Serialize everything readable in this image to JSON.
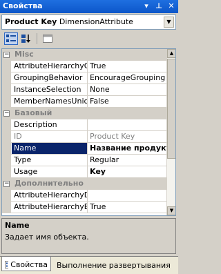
{
  "window": {
    "title": "Свойства",
    "pin_glyph": "▾",
    "autohide_glyph": "⊥",
    "close_glyph": "✕"
  },
  "object": {
    "name": "Product Key",
    "type": "DimensionAttribute",
    "dropdown_glyph": "▼"
  },
  "toolbar": {
    "categorized": "categorized-icon",
    "alphabetical": "sort-alpha-icon",
    "pages": "property-pages-icon"
  },
  "grid": {
    "misc": {
      "title": "Misc",
      "expander": "−",
      "rows": [
        {
          "name": "AttributeHierarchyOrc",
          "value": "True"
        },
        {
          "name": "GroupingBehavior",
          "value": "EncourageGrouping"
        },
        {
          "name": "InstanceSelection",
          "value": "None"
        },
        {
          "name": "MemberNamesUnique",
          "value": "False"
        }
      ]
    },
    "basic": {
      "title": "Базовый",
      "expander": "−",
      "rows": [
        {
          "name": "Description",
          "value": ""
        },
        {
          "name": "ID",
          "value": "Product Key"
        },
        {
          "name": "Name",
          "value": "Название продукт"
        },
        {
          "name": "Type",
          "value": "Regular"
        },
        {
          "name": "Usage",
          "value": "Key"
        }
      ]
    },
    "advanced": {
      "title": "Дополнительно",
      "expander": "−",
      "rows": [
        {
          "name": "AttributeHierarchyDisp",
          "value": ""
        },
        {
          "name": "AttributeHierarchyEna",
          "value": "True"
        }
      ]
    }
  },
  "description": {
    "title": "Name",
    "text": "Задает имя объекта."
  },
  "tabs": [
    {
      "label": "Свойства"
    },
    {
      "label": "Выполнение развертывания"
    }
  ]
}
